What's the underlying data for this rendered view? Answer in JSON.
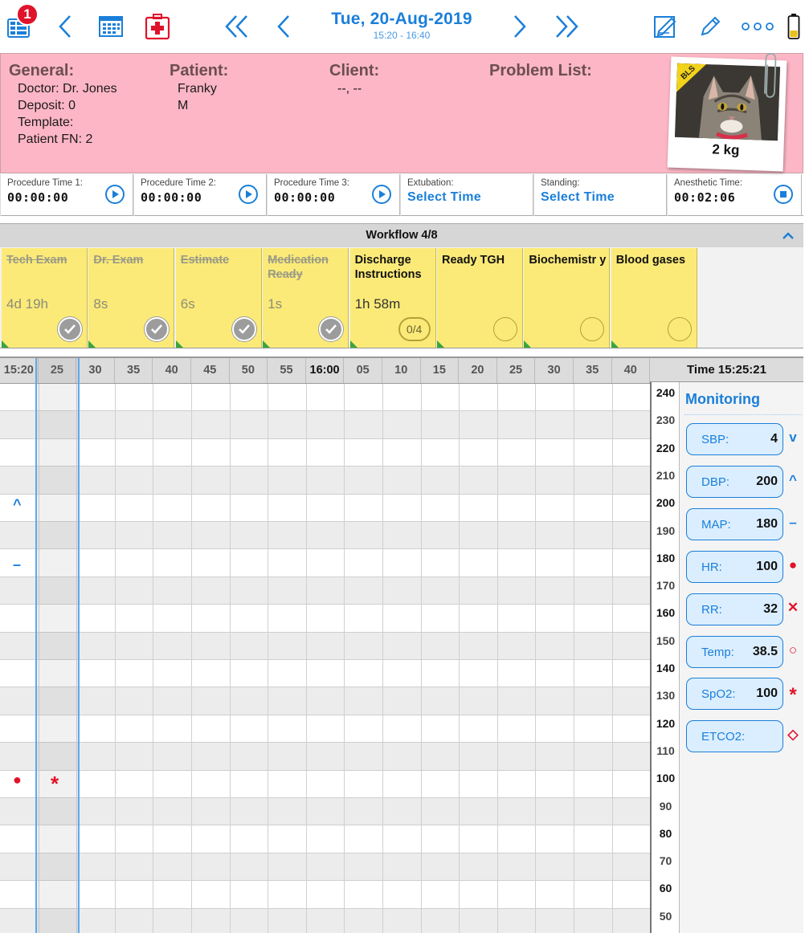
{
  "toolbar": {
    "badge_count": "1",
    "date": "Tue, 20-Aug-2019",
    "time_range": "15:20 - 16:40"
  },
  "info": {
    "general": {
      "heading": "General:",
      "lines": [
        "Doctor: Dr. Jones",
        "Deposit: 0",
        "Template:",
        "Patient FN: 2"
      ]
    },
    "patient": {
      "heading": "Patient:",
      "lines": [
        "Franky",
        "M"
      ]
    },
    "client": {
      "heading": "Client:",
      "lines": [
        "--, --"
      ]
    },
    "problem_list": {
      "heading": "Problem List:"
    },
    "photo_banner": "BLS",
    "weight": "2 kg"
  },
  "procedure_bar": [
    {
      "label": "Procedure Time 1:",
      "value": "00:00:00",
      "button": "play"
    },
    {
      "label": "Procedure Time 2:",
      "value": "00:00:00",
      "button": "play"
    },
    {
      "label": "Procedure Time 3:",
      "value": "00:00:00",
      "button": "play"
    },
    {
      "label": "Extubation:",
      "value": "Select Time",
      "button": ""
    },
    {
      "label": "Standing:",
      "value": "Select Time",
      "button": ""
    },
    {
      "label": "Anesthetic Time:",
      "value": "00:02:06",
      "button": "stop"
    }
  ],
  "workflow": {
    "title": "Workflow 4/8",
    "cards": [
      {
        "title": "Tech Exam",
        "time": "4d 19h",
        "status": "done"
      },
      {
        "title": "Dr. Exam",
        "time": "8s",
        "status": "done"
      },
      {
        "title": "Estimate",
        "time": "6s",
        "status": "done"
      },
      {
        "title": "Medication Ready",
        "time": "1s",
        "status": "done"
      },
      {
        "title": "Discharge Instructions",
        "time": "1h 58m",
        "status": "progress",
        "progress": "0/4"
      },
      {
        "title": "Ready TGH",
        "time": "",
        "status": "empty"
      },
      {
        "title": "Biochemistr y",
        "time": "",
        "status": "empty"
      },
      {
        "title": "Blood gases",
        "time": "",
        "status": "empty"
      }
    ]
  },
  "timeline": {
    "columns": [
      "15:20",
      "25",
      "30",
      "35",
      "40",
      "45",
      "50",
      "55",
      "16:00",
      "05",
      "10",
      "15",
      "20",
      "25",
      "30",
      "35",
      "40"
    ],
    "current_time": "Time 15:25:21",
    "scale": [
      "240",
      "230",
      "220",
      "210",
      "200",
      "190",
      "180",
      "170",
      "160",
      "150",
      "140",
      "130",
      "120",
      "110",
      "100",
      "90",
      "80",
      "70",
      "60",
      "50"
    ]
  },
  "monitoring": {
    "title": "Monitoring",
    "vitals": [
      {
        "label": "SBP:",
        "value": "4",
        "symbol": "v",
        "color": "#1a7fd9"
      },
      {
        "label": "DBP:",
        "value": "200",
        "symbol": "^",
        "color": "#1a7fd9"
      },
      {
        "label": "MAP:",
        "value": "180",
        "symbol": "–",
        "color": "#1a7fd9"
      },
      {
        "label": "HR:",
        "value": "100",
        "symbol": "●",
        "color": "#e0132a"
      },
      {
        "label": "RR:",
        "value": "32",
        "symbol": "✕",
        "color": "#e0132a"
      },
      {
        "label": "Temp:",
        "value": "38.5",
        "symbol": "○",
        "color": "#e0132a"
      },
      {
        "label": "SpO2:",
        "value": "100",
        "symbol": "*",
        "color": "#e0132a"
      },
      {
        "label": "ETCO2:",
        "value": "",
        "symbol": "◇",
        "color": "#e0132a"
      }
    ]
  },
  "colors": {
    "accent": "#1a7fd9",
    "info_panel": "#fdb6c5",
    "card": "#fbea78",
    "alert": "#e0132a"
  }
}
